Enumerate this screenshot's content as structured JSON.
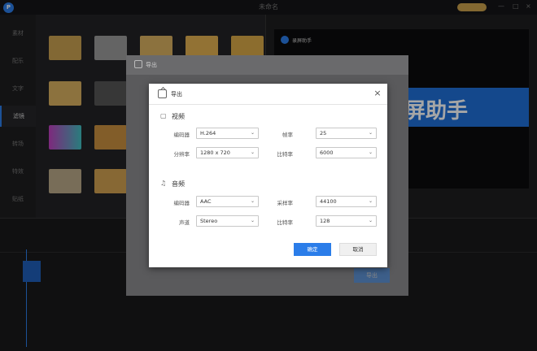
{
  "app": {
    "title": "未命名",
    "logo_letter": "↱"
  },
  "colors": {
    "accent": "#2b7de9",
    "dialog_bg": "#ffffff",
    "app_bg": "#1b1b1d"
  },
  "left_nav": {
    "items": [
      {
        "label": "素材"
      },
      {
        "label": "配乐"
      },
      {
        "label": "文字"
      },
      {
        "label": "滤镜"
      },
      {
        "label": "转场"
      },
      {
        "label": "特效"
      },
      {
        "label": "贴纸"
      }
    ],
    "active_index": 3
  },
  "preview": {
    "brand": "录屏助手",
    "big_text": "屏助手"
  },
  "outer_dialog": {
    "title": "导出",
    "export_button": "导出"
  },
  "dialog": {
    "title": "导出",
    "close_icon": "×",
    "video": {
      "section_title": "视频",
      "encoder_label": "编码器",
      "encoder_value": "H.264",
      "framerate_label": "帧率",
      "framerate_value": "25",
      "resolution_label": "分辨率",
      "resolution_value": "1280 x 720",
      "bitrate_label": "比特率",
      "bitrate_value": "6000"
    },
    "audio": {
      "section_title": "音频",
      "encoder_label": "编码器",
      "encoder_value": "AAC",
      "samplerate_label": "采样率",
      "samplerate_value": "44100",
      "channel_label": "声道",
      "channel_value": "Stereo",
      "bitrate_label": "比特率",
      "bitrate_value": "128"
    },
    "confirm_label": "确定",
    "cancel_label": "取消"
  }
}
